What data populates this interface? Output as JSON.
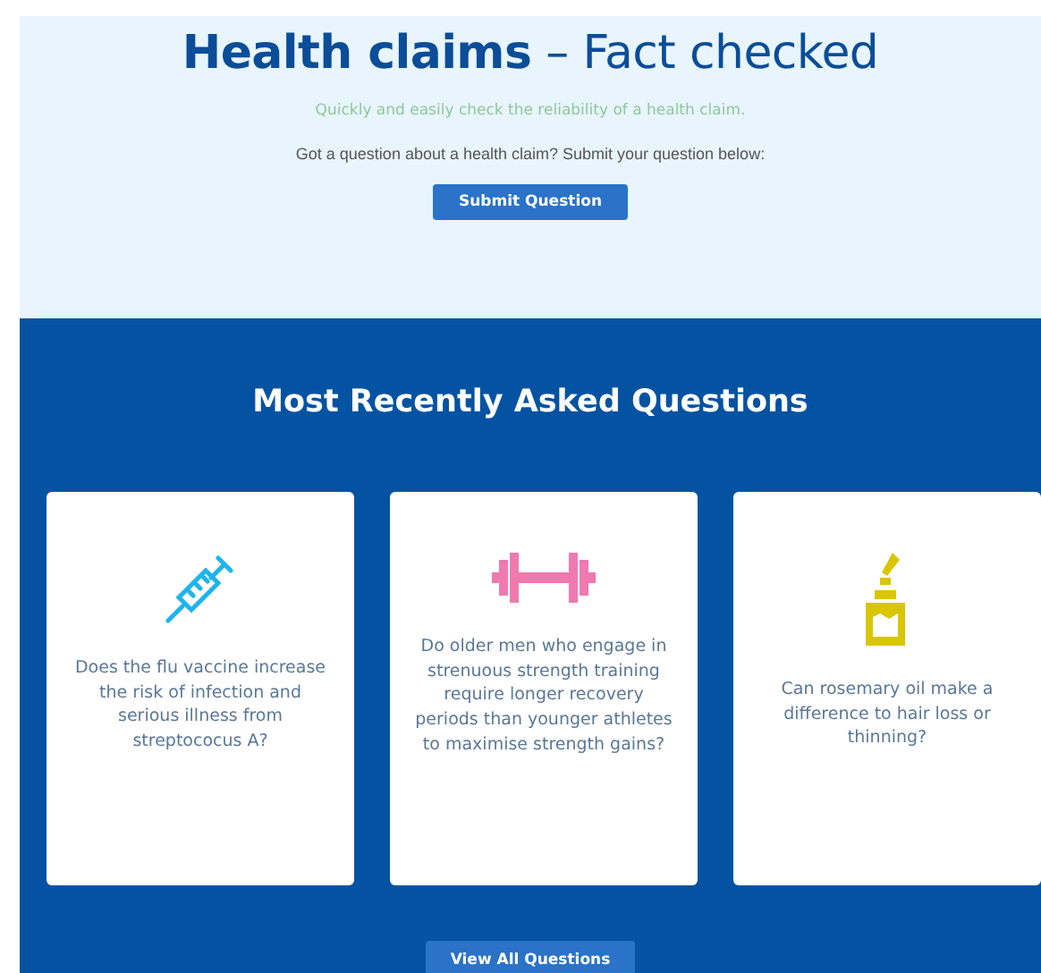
{
  "header": {
    "title": "**Health claims** – Fact checked",
    "tagline": "Quickly and easily check the reliability of a health claim.",
    "prompt": "Got a question about a health claim? Submit your question below:",
    "button": "Submit Question"
  },
  "recent": {
    "heading": "Most Recently Asked Questions",
    "cards": [
      {
        "kind": "syringe",
        "color": "#1eb4f0",
        "question": "Does the flu vaccine increase the risk of infection and serious illness from streptococus A?"
      },
      {
        "kind": "dumbbell",
        "color": "#ee7ab0",
        "question": "Do older men who engage in strenuous strength training require longer recovery periods than younger athletes to maximise strength gains?"
      },
      {
        "kind": "dropper",
        "color": "#d9c600",
        "question": "Can rosemary oil make a difference to hair loss or thinning?"
      }
    ],
    "button": "View All Questions"
  }
}
